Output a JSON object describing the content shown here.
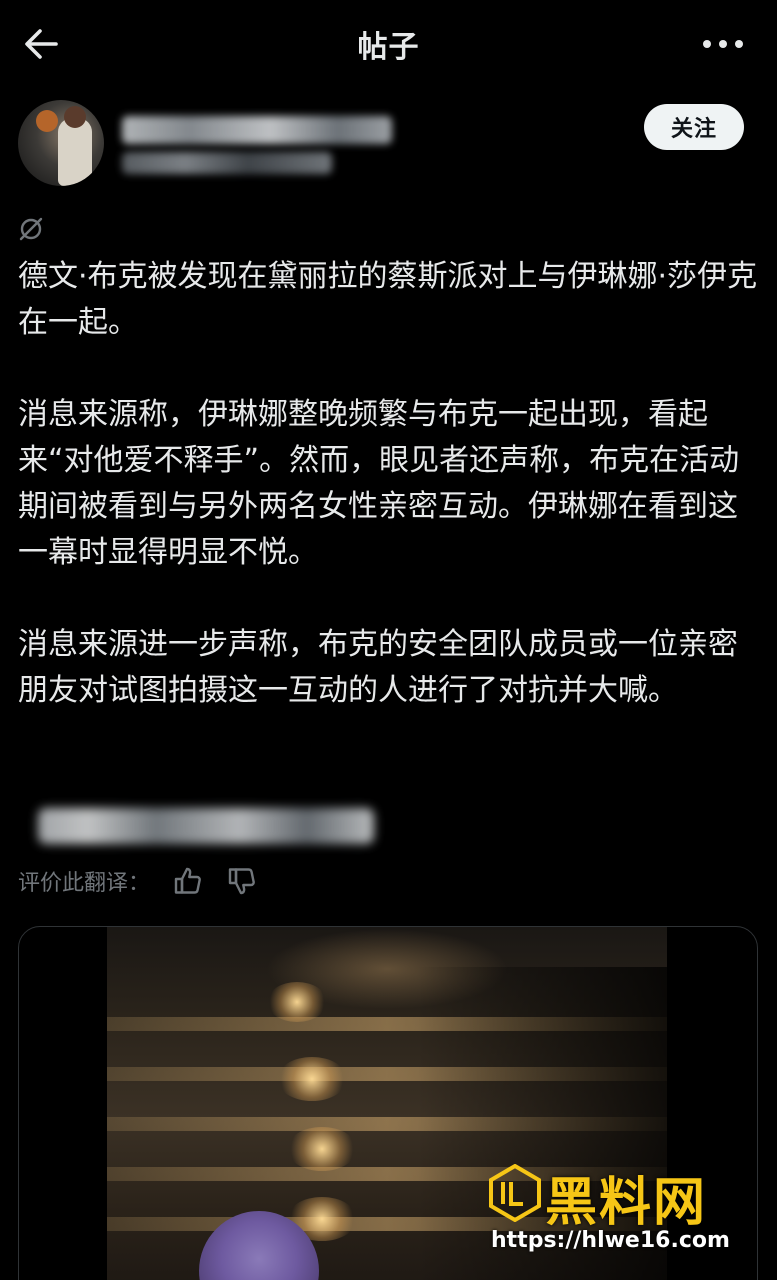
{
  "header": {
    "title": "帖子"
  },
  "author": {
    "follow_label": "关注"
  },
  "post": {
    "paragraphs": [
      "德文·布克被发现在黛丽拉的蔡斯派对上与伊琳娜·莎伊克在一起。",
      "消息来源称，伊琳娜整晚频繁与布克一起出现，看起来“对他爱不释手”。然而，眼见者还声称，布克在活动期间被看到与另外两名女性亲密互动。伊琳娜在看到这一幕时显得明显不悦。",
      "消息来源进一步声称，布克的安全团队成员或一位亲密朋友对试图拍摄这一互动的人进行了对抗并大喊。"
    ],
    "rate_label": "评价此翻译："
  },
  "watermark": {
    "name": "黑料网",
    "url": "https://hlwe16.com"
  },
  "colors": {
    "background": "#000000",
    "text": "#e7e9ea",
    "muted": "#71767b",
    "watermark": "#f6c616"
  },
  "icons": {
    "back": "arrow-left-icon",
    "more": "more-horizontal-icon",
    "translate": "translate-icon",
    "thumb_up": "thumb-up-icon",
    "thumb_down": "thumb-down-icon"
  }
}
